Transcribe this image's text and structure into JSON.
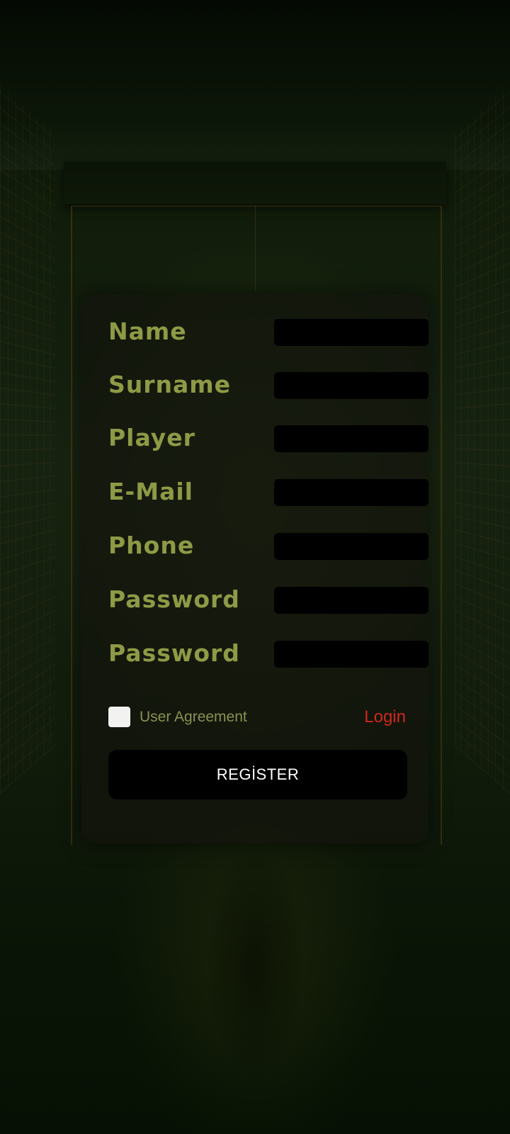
{
  "form": {
    "fields": [
      {
        "label": "Name",
        "value": ""
      },
      {
        "label": "Surname",
        "value": ""
      },
      {
        "label": "Player",
        "value": ""
      },
      {
        "label": "E-Mail",
        "value": ""
      },
      {
        "label": "Phone",
        "value": ""
      },
      {
        "label": "Password",
        "value": ""
      },
      {
        "label": "Password",
        "value": ""
      }
    ],
    "agreement_label": "User Agreement",
    "agreement_checked": false,
    "login_label": "Login",
    "register_label": "REGİSTER"
  },
  "colors": {
    "label": "#8e9a45",
    "login": "#d0281c",
    "field_bg": "#000000",
    "button_bg": "#000000",
    "button_text": "#ffffff"
  }
}
